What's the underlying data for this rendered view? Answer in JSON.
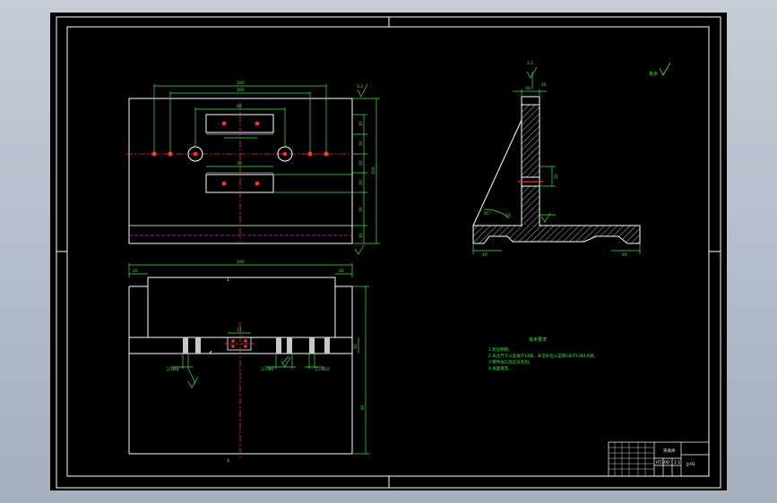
{
  "colors": {
    "background": "#000000",
    "outline": "#ffffff",
    "dimension": "#38e838",
    "centerline": "#ff2a2a",
    "hidden_line": "#d02ad0",
    "hatch": "#ffffff",
    "window": "#b4bdca"
  },
  "top_view": {
    "dim_overall": "200",
    "dim_inner": "160",
    "dim_slot": "60",
    "dim_lower": "70",
    "dim_right": "150",
    "right_dims": [
      "10",
      "30",
      "20",
      "20",
      "30",
      "10"
    ],
    "roughness": "3.2"
  },
  "front_view": {
    "dim_overall": "200",
    "dim_left": "20",
    "dim_right": "20",
    "dim_hole": "12",
    "dim_right_height": "80",
    "dim_right_small": "10",
    "callout_1": "2×M8",
    "callout_2": "2×M6",
    "callout_3": "2×Φ10",
    "section_mark": "L"
  },
  "side_view": {
    "dim_top": "30",
    "dim_flange": "20",
    "dim_side": "20",
    "dim_angle": "45°",
    "dim_base_left": "40",
    "dim_base_right": "40",
    "dim_hole": "10",
    "roughness": "3.2"
  },
  "general_roughness": "其余",
  "notes": {
    "title": "技术要求",
    "lines": [
      "1.锐边倒钝。",
      "2.未注尺寸公差按IT14级，未注形位公差按GB/T1184-K级。",
      "3.零件加工后应去毛刺。",
      "4.表面发黑。"
    ]
  },
  "title_block": {
    "part_name": "夹具体",
    "material": "HT200",
    "scale": "1:1",
    "drawing_no": "JJ-01"
  }
}
